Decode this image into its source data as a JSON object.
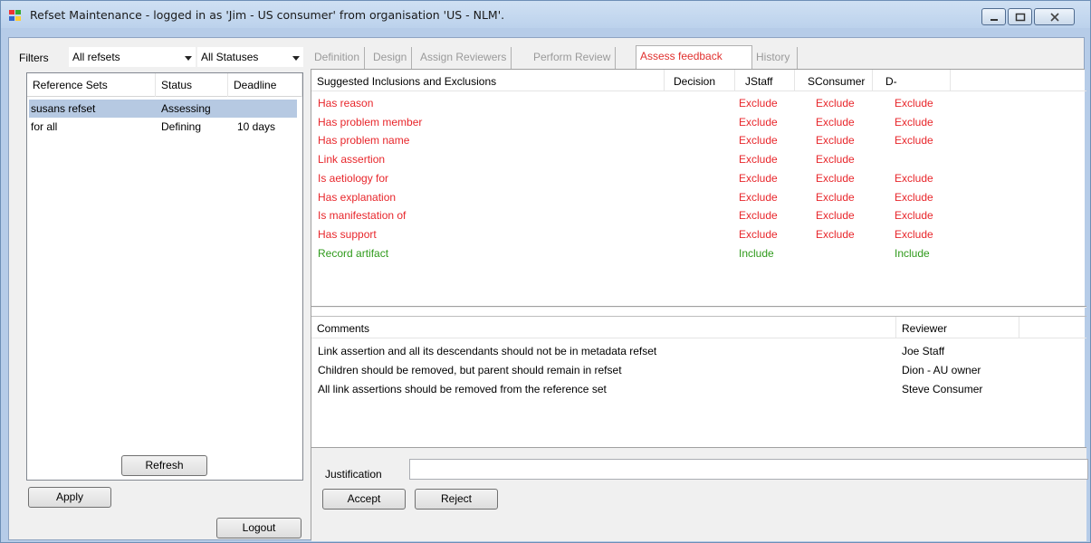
{
  "window": {
    "title": "Refset Maintenance - logged in as 'Jim - US consumer' from organisation 'US - NLM'."
  },
  "filters": {
    "label": "Filters",
    "refsets_value": "All refsets",
    "status_value": "All Statuses"
  },
  "refsets": {
    "headers": [
      "Reference Sets",
      "Status",
      "Deadline"
    ],
    "rows": [
      {
        "name": "susans refset",
        "status": "Assessing",
        "deadline": "",
        "selected": true
      },
      {
        "name": "for all",
        "status": "Defining",
        "deadline": "10 days",
        "selected": false
      }
    ]
  },
  "buttons": {
    "refresh": "Refresh",
    "apply": "Apply",
    "logout": "Logout",
    "accept": "Accept",
    "reject": "Reject"
  },
  "tabs": [
    "Definition",
    "Design",
    "Assign Reviewers",
    "Perform Review",
    "Assess feedback",
    "History"
  ],
  "active_tab": "Assess feedback",
  "suggestions": {
    "headers": [
      "Suggested Inclusions and Exclusions",
      "Decision",
      "JStaff",
      "SConsumer",
      "D-"
    ],
    "rows": [
      {
        "name": "Has reason",
        "decision": "",
        "jstaff": "Exclude",
        "sconsumer": "Exclude",
        "d": "Exclude",
        "color": "#e8262b"
      },
      {
        "name": "Has problem member",
        "decision": "",
        "jstaff": "Exclude",
        "sconsumer": "Exclude",
        "d": "Exclude",
        "color": "#e8262b"
      },
      {
        "name": "Has problem name",
        "decision": "",
        "jstaff": "Exclude",
        "sconsumer": "Exclude",
        "d": "Exclude",
        "color": "#e8262b"
      },
      {
        "name": "Link assertion",
        "decision": "",
        "jstaff": "Exclude",
        "sconsumer": "Exclude",
        "d": "",
        "color": "#e8262b"
      },
      {
        "name": "Is aetiology for",
        "decision": "",
        "jstaff": "Exclude",
        "sconsumer": "Exclude",
        "d": "Exclude",
        "color": "#e8262b"
      },
      {
        "name": "Has explanation",
        "decision": "",
        "jstaff": "Exclude",
        "sconsumer": "Exclude",
        "d": "Exclude",
        "color": "#e8262b"
      },
      {
        "name": "Is manifestation of",
        "decision": "",
        "jstaff": "Exclude",
        "sconsumer": "Exclude",
        "d": "Exclude",
        "color": "#e8262b"
      },
      {
        "name": "Has support",
        "decision": "",
        "jstaff": "Exclude",
        "sconsumer": "Exclude",
        "d": "Exclude",
        "color": "#e8262b"
      },
      {
        "name": "Record artifact",
        "decision": "",
        "jstaff": "Include",
        "sconsumer": "",
        "d": "Include",
        "color": "#2f9a1b"
      }
    ]
  },
  "comments": {
    "headers": [
      "Comments",
      "Reviewer"
    ],
    "rows": [
      {
        "comment": "Link assertion and all its descendants should not be in metadata refset",
        "reviewer": "Joe Staff"
      },
      {
        "comment": "Children should be removed, but parent should remain in refset",
        "reviewer": "Dion - AU owner"
      },
      {
        "comment": "All link assertions should be removed from the reference set",
        "reviewer": "Steve Consumer"
      }
    ]
  },
  "justification": {
    "label": "Justification",
    "value": ""
  },
  "colors": {
    "exclude": "#e8262b",
    "include": "#2f9a1b",
    "active_tab": "#e0302e",
    "selection": "#b6c9e2"
  }
}
